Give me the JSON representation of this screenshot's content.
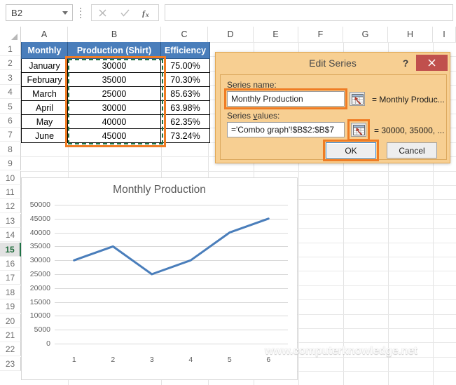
{
  "app": "excel-worksheet-with-edit-series-dialog",
  "formula_bar": {
    "name_box_value": "B2",
    "name_box_dropdown_icon": "chevron-down-icon",
    "cancel_icon": "close-x-icon",
    "confirm_icon": "check-icon",
    "function_icon": "fx-icon",
    "formula_value": "",
    "formula_placeholder": ""
  },
  "sheet": {
    "columns": [
      "A",
      "B",
      "C",
      "D",
      "E",
      "F",
      "G",
      "H",
      "I"
    ],
    "rows": [
      1,
      2,
      3,
      4,
      5,
      6,
      7,
      8,
      9,
      10,
      11,
      12,
      13,
      14,
      15,
      16,
      17,
      18,
      19,
      20,
      21,
      22,
      23
    ],
    "active_row": 15,
    "selected_range_label": "B2:B7",
    "header_fill": "#4a7ebb",
    "selection_outline": "#ef7c24",
    "marching_ants": "#1e7145",
    "table": {
      "headers": [
        "Monthly",
        "Production (Shirt)",
        "Efficiency"
      ],
      "rows": [
        [
          "January",
          "30000",
          "75.00%"
        ],
        [
          "February",
          "35000",
          "70.30%"
        ],
        [
          "March",
          "25000",
          "85.63%"
        ],
        [
          "April",
          "30000",
          "63.98%"
        ],
        [
          "May",
          "40000",
          "62.35%"
        ],
        [
          "June",
          "45000",
          "73.24%"
        ]
      ]
    }
  },
  "chart_data": {
    "type": "line",
    "title": "Monthly Production",
    "categories": [
      "1",
      "2",
      "3",
      "4",
      "5",
      "6"
    ],
    "values": [
      30000,
      35000,
      25000,
      30000,
      40000,
      45000
    ],
    "series": [
      {
        "name": "Monthly Production",
        "values": [
          30000,
          35000,
          25000,
          30000,
          40000,
          45000
        ]
      }
    ],
    "yticks": [
      0,
      5000,
      10000,
      15000,
      20000,
      25000,
      30000,
      35000,
      40000,
      45000,
      50000
    ],
    "ytick_labels": [
      "0",
      "5000",
      "10000",
      "15000",
      "20000",
      "25000",
      "30000",
      "35000",
      "40000",
      "45000",
      "50000"
    ],
    "ylim": [
      0,
      50000
    ],
    "xlabel": "",
    "ylabel": "",
    "grid": true,
    "legend": false,
    "line_color": "#4a7ebb",
    "line_width": 3
  },
  "dialog": {
    "title": "Edit Series",
    "help_icon": "question-mark-icon",
    "close_icon": "close-x-icon",
    "series_name_label": "Series name:",
    "series_name_value": "Monthly Production",
    "series_name_result": "= Monthly Produc...",
    "series_values_label_pre": "Series ",
    "series_values_label_accel": "v",
    "series_values_label_post": "alues:",
    "series_values_value": "='Combo graph'!$B$2:$B$7",
    "series_values_result": "= 30000, 35000, ...",
    "range_picker_icon": "range-selector-icon",
    "ok_label": "OK",
    "cancel_label": "Cancel",
    "title_bar_color": "#f7cf92",
    "close_button_color": "#c0504d",
    "highlight_color": "#ef7c24"
  },
  "watermark": {
    "text": "www.computerknowledge.net"
  }
}
